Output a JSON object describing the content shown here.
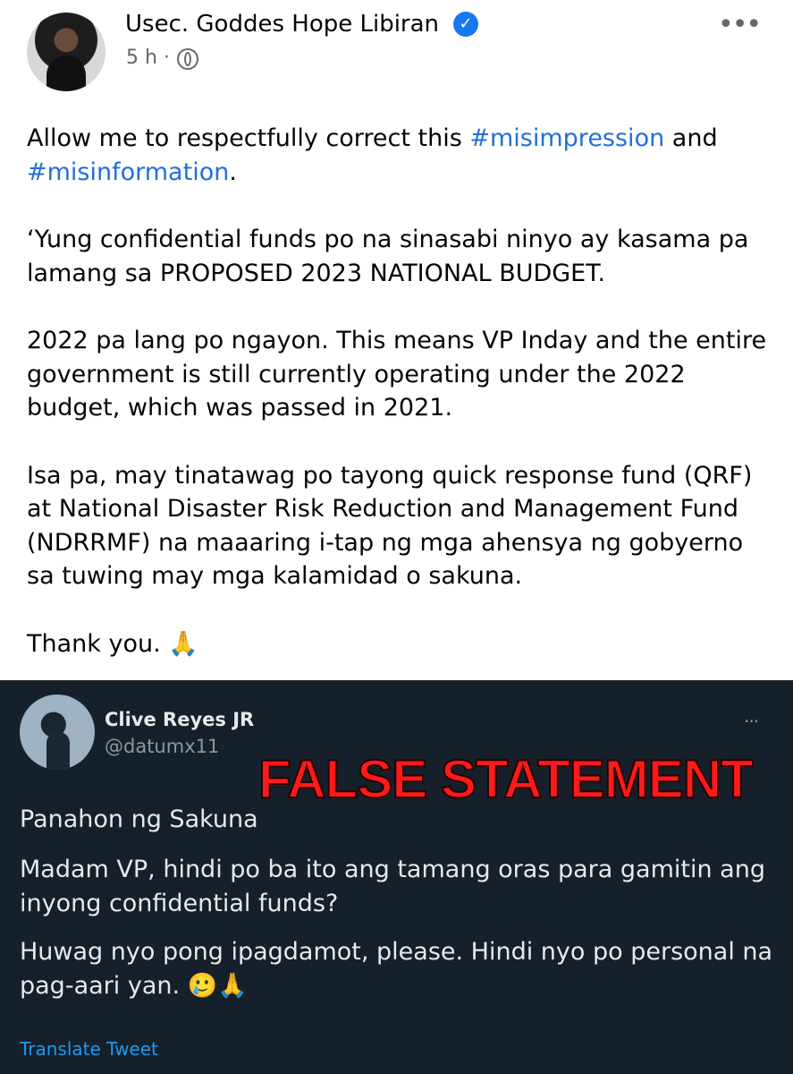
{
  "facebook_post": {
    "author": "Usec. Goddes Hope Libiran",
    "timestamp": "5 h ·",
    "verified_icon": "verified-badge-icon",
    "paragraphs": {
      "p1_pre": "Allow me to respectfully correct this ",
      "p1_hash1": "#misimpression",
      "p1_mid": " and ",
      "p1_hash2": "#misinformation",
      "p1_post": ".",
      "p2": "‘Yung confidential funds po na sinasabi ninyo ay kasama pa lamang sa PROPOSED 2023 NATIONAL BUDGET.",
      "p3": "2022 pa lang po ngayon. This means VP Inday and the entire government is still currently operating under the 2022 budget, which was passed in 2021.",
      "p4": "Isa pa, may tinatawag po tayong quick response fund (QRF) at National Disaster Risk Reduction and Management Fund (NDRRMF) na maaaring i-tap ng mga ahensya ng gobyerno sa tuwing may mga kalamidad o sakuna.",
      "p5": "Thank you. 🙏"
    },
    "hashtag_color": "#216fdb"
  },
  "tweet": {
    "name": "Clive Reyes JR",
    "handle": "@datumx11",
    "overlay_label": "FALSE STATEMENT",
    "line1": "Panahon ng Sakuna",
    "line2": "Madam VP, hindi po ba ito ang tamang oras para gamitin ang inyong confidential funds?",
    "line3": "Huwag nyo pong ipagdamot, please. Hindi nyo po personal na pag-aari yan. 🥲🙏",
    "translate": "Translate Tweet",
    "bg_color": "#15202b"
  }
}
